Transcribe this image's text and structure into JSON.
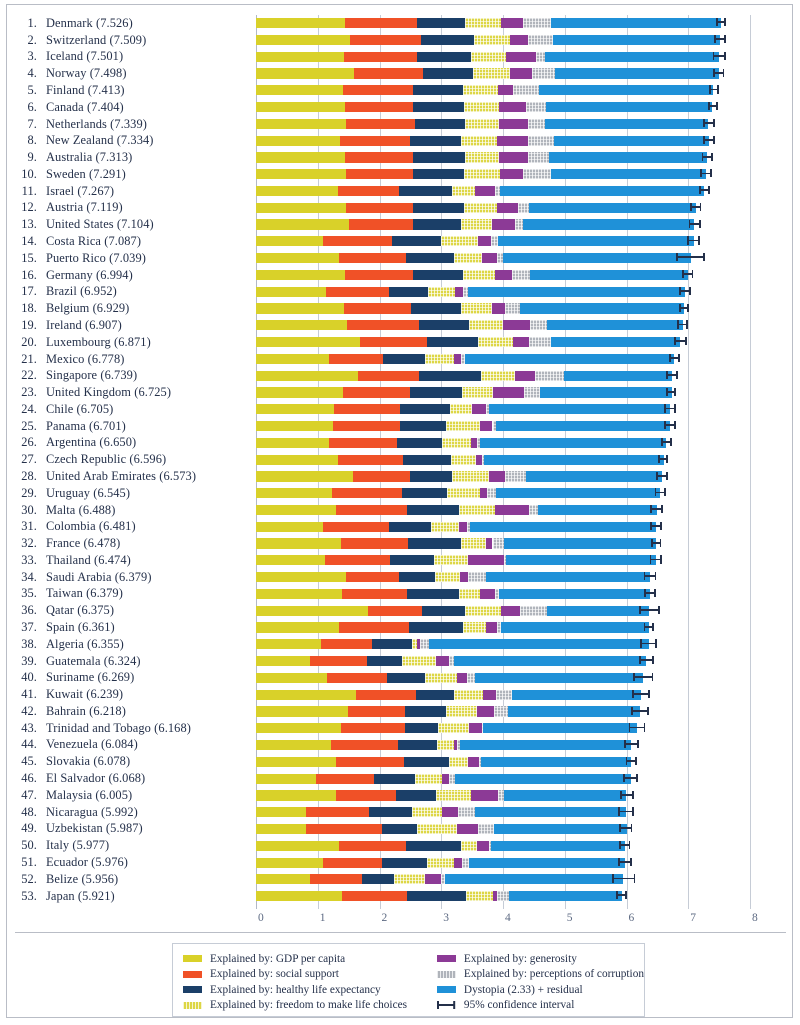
{
  "chart_data": {
    "type": "bar",
    "subtype": "stacked-horizontal",
    "title": "",
    "xlabel": "",
    "ylabel": "",
    "xlim": [
      0,
      8
    ],
    "xticks": [
      "0",
      "1",
      "2",
      "3",
      "4",
      "5",
      "6",
      "7",
      "8"
    ],
    "grid": true,
    "legend_position": "bottom",
    "series": [
      {
        "name": "Explained by: GDP per capita",
        "key": "gdp",
        "color": "#d9d129"
      },
      {
        "name": "Explained by: social support",
        "key": "social",
        "color": "#f05127"
      },
      {
        "name": "Explained by: healthy life expectancy",
        "key": "health",
        "color": "#1b3f68"
      },
      {
        "name": "Explained by: freedom to make life choices",
        "key": "freedom",
        "color": "#ddd645"
      },
      {
        "name": "Explained by: generosity",
        "key": "generosity",
        "color": "#8c3a96"
      },
      {
        "name": "Explained by: perceptions of corruption",
        "key": "corruption",
        "color": "#b0b4bb"
      },
      {
        "name": "Dystopia (2.33) + residual",
        "key": "dystopia",
        "color": "#1f91d8"
      }
    ],
    "rows": [
      {
        "rank": "1.",
        "country": "Denmark",
        "score": "7.526",
        "gdp": 1.44,
        "social": 1.16,
        "health": 0.79,
        "freedom": 0.58,
        "generosity": 0.36,
        "corruption": 0.44,
        "dystopia": 2.76,
        "ci_lo": 7.46,
        "ci_hi": 7.59
      },
      {
        "rank": "2.",
        "country": "Switzerland",
        "score": "7.509",
        "gdp": 1.53,
        "social": 1.14,
        "health": 0.86,
        "freedom": 0.59,
        "generosity": 0.28,
        "corruption": 0.41,
        "dystopia": 2.7,
        "ci_lo": 7.43,
        "ci_hi": 7.59
      },
      {
        "rank": "3.",
        "country": "Iceland",
        "score": "7.501",
        "gdp": 1.43,
        "social": 1.18,
        "health": 0.87,
        "freedom": 0.57,
        "generosity": 0.48,
        "corruption": 0.15,
        "dystopia": 2.82,
        "ci_lo": 7.41,
        "ci_hi": 7.59
      },
      {
        "rank": "4.",
        "country": "Norway",
        "score": "7.498",
        "gdp": 1.58,
        "social": 1.13,
        "health": 0.8,
        "freedom": 0.6,
        "generosity": 0.36,
        "corruption": 0.38,
        "dystopia": 2.65,
        "ci_lo": 7.42,
        "ci_hi": 7.57
      },
      {
        "rank": "5.",
        "country": "Finland",
        "score": "7.413",
        "gdp": 1.41,
        "social": 1.13,
        "health": 0.81,
        "freedom": 0.57,
        "generosity": 0.25,
        "corruption": 0.41,
        "dystopia": 2.82,
        "ci_lo": 7.35,
        "ci_hi": 7.48
      },
      {
        "rank": "6.",
        "country": "Canada",
        "score": "7.404",
        "gdp": 1.44,
        "social": 1.1,
        "health": 0.83,
        "freedom": 0.57,
        "generosity": 0.43,
        "corruption": 0.32,
        "dystopia": 2.7,
        "ci_lo": 7.34,
        "ci_hi": 7.47
      },
      {
        "rank": "7.",
        "country": "Netherlands",
        "score": "7.339",
        "gdp": 1.46,
        "social": 1.11,
        "health": 0.81,
        "freedom": 0.55,
        "generosity": 0.47,
        "corruption": 0.28,
        "dystopia": 2.64,
        "ci_lo": 7.26,
        "ci_hi": 7.42
      },
      {
        "rank": "8.",
        "country": "New Zealand",
        "score": "7.334",
        "gdp": 1.36,
        "social": 1.13,
        "health": 0.83,
        "freedom": 0.58,
        "generosity": 0.5,
        "corruption": 0.42,
        "dystopia": 2.51,
        "ci_lo": 7.25,
        "ci_hi": 7.42
      },
      {
        "rank": "9.",
        "country": "Australia",
        "score": "7.313",
        "gdp": 1.44,
        "social": 1.11,
        "health": 0.83,
        "freedom": 0.56,
        "generosity": 0.47,
        "corruption": 0.33,
        "dystopia": 2.57,
        "ci_lo": 7.23,
        "ci_hi": 7.39
      },
      {
        "rank": "10.",
        "country": "Sweden",
        "score": "7.291",
        "gdp": 1.45,
        "social": 1.09,
        "health": 0.83,
        "freedom": 0.58,
        "generosity": 0.38,
        "corruption": 0.44,
        "dystopia": 2.52,
        "ci_lo": 7.21,
        "ci_hi": 7.37
      },
      {
        "rank": "11.",
        "country": "Israel",
        "score": "7.267",
        "gdp": 1.33,
        "social": 0.99,
        "health": 0.85,
        "freedom": 0.37,
        "generosity": 0.33,
        "corruption": 0.08,
        "dystopia": 3.31,
        "ci_lo": 7.19,
        "ci_hi": 7.34
      },
      {
        "rank": "12.",
        "country": "Austria",
        "score": "7.119",
        "gdp": 1.45,
        "social": 1.09,
        "health": 0.83,
        "freedom": 0.54,
        "generosity": 0.33,
        "corruption": 0.18,
        "dystopia": 2.7,
        "ci_lo": 7.04,
        "ci_hi": 7.2
      },
      {
        "rank": "13.",
        "country": "United States",
        "score": "7.104",
        "gdp": 1.5,
        "social": 1.04,
        "health": 0.78,
        "freedom": 0.5,
        "generosity": 0.37,
        "corruption": 0.14,
        "dystopia": 2.77,
        "ci_lo": 7.02,
        "ci_hi": 7.19
      },
      {
        "rank": "14.",
        "country": "Costa Rica",
        "score": "7.087",
        "gdp": 1.09,
        "social": 1.11,
        "health": 0.79,
        "freedom": 0.6,
        "generosity": 0.22,
        "corruption": 0.11,
        "dystopia": 3.17,
        "ci_lo": 7.0,
        "ci_hi": 7.18
      },
      {
        "rank": "15.",
        "country": "Puerto Rico",
        "score": "7.039",
        "gdp": 1.35,
        "social": 1.08,
        "health": 0.77,
        "freedom": 0.46,
        "generosity": 0.24,
        "corruption": 0.1,
        "dystopia": 3.04,
        "ci_lo": 6.82,
        "ci_hi": 7.26
      },
      {
        "rank": "16.",
        "country": "Germany",
        "score": "6.994",
        "gdp": 1.44,
        "social": 1.1,
        "health": 0.81,
        "freedom": 0.52,
        "generosity": 0.28,
        "corruption": 0.28,
        "dystopia": 2.56,
        "ci_lo": 6.92,
        "ci_hi": 7.07
      },
      {
        "rank": "17.",
        "country": "Brazil",
        "score": "6.952",
        "gdp": 1.13,
        "social": 1.03,
        "health": 0.62,
        "freedom": 0.44,
        "generosity": 0.13,
        "corruption": 0.08,
        "dystopia": 3.52,
        "ci_lo": 6.87,
        "ci_hi": 7.03
      },
      {
        "rank": "18.",
        "country": "Belgium",
        "score": "6.929",
        "gdp": 1.42,
        "social": 1.09,
        "health": 0.81,
        "freedom": 0.5,
        "generosity": 0.21,
        "corruption": 0.25,
        "dystopia": 2.65,
        "ci_lo": 6.86,
        "ci_hi": 7.0
      },
      {
        "rank": "19.",
        "country": "Ireland",
        "score": "6.907",
        "gdp": 1.48,
        "social": 1.16,
        "health": 0.81,
        "freedom": 0.55,
        "generosity": 0.43,
        "corruption": 0.29,
        "dystopia": 2.19,
        "ci_lo": 6.83,
        "ci_hi": 6.98
      },
      {
        "rank": "20.",
        "country": "Luxembourg",
        "score": "6.871",
        "gdp": 1.69,
        "social": 1.08,
        "health": 0.82,
        "freedom": 0.58,
        "generosity": 0.25,
        "corruption": 0.35,
        "dystopia": 2.1,
        "ci_lo": 6.78,
        "ci_hi": 6.96
      },
      {
        "rank": "21.",
        "country": "Mexico",
        "score": "6.778",
        "gdp": 1.18,
        "social": 0.87,
        "health": 0.69,
        "freedom": 0.46,
        "generosity": 0.12,
        "corruption": 0.07,
        "dystopia": 3.38,
        "ci_lo": 6.71,
        "ci_hi": 6.85
      },
      {
        "rank": "22.",
        "country": "Singapore",
        "score": "6.739",
        "gdp": 1.65,
        "social": 0.99,
        "health": 1.0,
        "freedom": 0.56,
        "generosity": 0.32,
        "corruption": 0.47,
        "dystopia": 1.75,
        "ci_lo": 6.66,
        "ci_hi": 6.82
      },
      {
        "rank": "23.",
        "country": "United Kingdom",
        "score": "6.725",
        "gdp": 1.41,
        "social": 1.09,
        "health": 0.83,
        "freedom": 0.51,
        "generosity": 0.5,
        "corruption": 0.26,
        "dystopia": 2.13,
        "ci_lo": 6.66,
        "ci_hi": 6.79
      },
      {
        "rank": "24.",
        "country": "Chile",
        "score": "6.705",
        "gdp": 1.27,
        "social": 1.06,
        "health": 0.81,
        "freedom": 0.35,
        "generosity": 0.23,
        "corruption": 0.06,
        "dystopia": 2.93,
        "ci_lo": 6.62,
        "ci_hi": 6.79
      },
      {
        "rank": "25.",
        "country": "Panama",
        "score": "6.701",
        "gdp": 1.25,
        "social": 1.09,
        "health": 0.74,
        "freedom": 0.55,
        "generosity": 0.2,
        "corruption": 0.06,
        "dystopia": 2.81,
        "ci_lo": 6.62,
        "ci_hi": 6.78
      },
      {
        "rank": "26.",
        "country": "Argentina",
        "score": "6.650",
        "gdp": 1.19,
        "social": 1.1,
        "health": 0.72,
        "freedom": 0.47,
        "generosity": 0.1,
        "corruption": 0.05,
        "dystopia": 3.01,
        "ci_lo": 6.58,
        "ci_hi": 6.72
      },
      {
        "rank": "27.",
        "country": "Czech Republic",
        "score": "6.596",
        "gdp": 1.32,
        "social": 1.06,
        "health": 0.77,
        "freedom": 0.42,
        "generosity": 0.09,
        "corruption": 0.03,
        "dystopia": 2.91,
        "ci_lo": 6.53,
        "ci_hi": 6.66
      },
      {
        "rank": "28.",
        "country": "United Arab Emirates",
        "score": "6.573",
        "gdp": 1.57,
        "social": 0.92,
        "health": 0.69,
        "freedom": 0.6,
        "generosity": 0.26,
        "corruption": 0.34,
        "dystopia": 2.19,
        "ci_lo": 6.49,
        "ci_hi": 6.66
      },
      {
        "rank": "29.",
        "country": "Uruguay",
        "score": "6.545",
        "gdp": 1.23,
        "social": 1.13,
        "health": 0.74,
        "freedom": 0.52,
        "generosity": 0.12,
        "corruption": 0.15,
        "dystopia": 2.66,
        "ci_lo": 6.47,
        "ci_hi": 6.62
      },
      {
        "rank": "30.",
        "country": "Malta",
        "score": "6.488",
        "gdp": 1.3,
        "social": 1.15,
        "health": 0.83,
        "freedom": 0.59,
        "generosity": 0.55,
        "corruption": 0.14,
        "dystopia": 1.93,
        "ci_lo": 6.4,
        "ci_hi": 6.58
      },
      {
        "rank": "31.",
        "country": "Colombia",
        "score": "6.481",
        "gdp": 1.08,
        "social": 1.07,
        "health": 0.68,
        "freedom": 0.46,
        "generosity": 0.13,
        "corruption": 0.04,
        "dystopia": 3.02,
        "ci_lo": 6.4,
        "ci_hi": 6.56
      },
      {
        "rank": "32.",
        "country": "France",
        "score": "6.478",
        "gdp": 1.38,
        "social": 1.08,
        "health": 0.86,
        "freedom": 0.4,
        "generosity": 0.11,
        "corruption": 0.19,
        "dystopia": 2.46,
        "ci_lo": 6.41,
        "ci_hi": 6.55
      },
      {
        "rank": "33.",
        "country": "Thailand",
        "score": "6.474",
        "gdp": 1.11,
        "social": 1.06,
        "health": 0.71,
        "freedom": 0.56,
        "generosity": 0.58,
        "corruption": 0.03,
        "dystopia": 2.43,
        "ci_lo": 6.39,
        "ci_hi": 6.56
      },
      {
        "rank": "34.",
        "country": "Saudi Arabia",
        "score": "6.379",
        "gdp": 1.46,
        "social": 0.85,
        "health": 0.59,
        "freedom": 0.41,
        "generosity": 0.13,
        "corruption": 0.29,
        "dystopia": 2.65,
        "ci_lo": 6.29,
        "ci_hi": 6.47
      },
      {
        "rank": "35.",
        "country": "Taiwan",
        "score": "6.379",
        "gdp": 1.39,
        "social": 1.05,
        "health": 0.84,
        "freedom": 0.34,
        "generosity": 0.25,
        "corruption": 0.06,
        "dystopia": 2.45,
        "ci_lo": 6.3,
        "ci_hi": 6.46
      },
      {
        "rank": "36.",
        "country": "Qatar",
        "score": "6.375",
        "gdp": 1.82,
        "social": 0.87,
        "health": 0.7,
        "freedom": 0.57,
        "generosity": 0.32,
        "corruption": 0.44,
        "dystopia": 1.65,
        "ci_lo": 6.22,
        "ci_hi": 6.53
      },
      {
        "rank": "37.",
        "country": "Spain",
        "score": "6.361",
        "gdp": 1.34,
        "social": 1.13,
        "health": 0.89,
        "freedom": 0.37,
        "generosity": 0.17,
        "corruption": 0.06,
        "dystopia": 2.4,
        "ci_lo": 6.29,
        "ci_hi": 6.43
      },
      {
        "rank": "38.",
        "country": "Algeria",
        "score": "6.355",
        "gdp": 1.05,
        "social": 0.83,
        "health": 0.64,
        "freedom": 0.09,
        "generosity": 0.05,
        "corruption": 0.14,
        "dystopia": 3.56,
        "ci_lo": 6.23,
        "ci_hi": 6.48
      },
      {
        "rank": "39.",
        "country": "Guatemala",
        "score": "6.324",
        "gdp": 0.87,
        "social": 0.93,
        "health": 0.57,
        "freedom": 0.54,
        "generosity": 0.22,
        "corruption": 0.07,
        "dystopia": 3.12,
        "ci_lo": 6.22,
        "ci_hi": 6.43
      },
      {
        "rank": "40.",
        "country": "Suriname",
        "score": "6.269",
        "gdp": 1.15,
        "social": 0.97,
        "health": 0.61,
        "freedom": 0.52,
        "generosity": 0.16,
        "corruption": 0.13,
        "dystopia": 2.73,
        "ci_lo": 6.12,
        "ci_hi": 6.42
      },
      {
        "rank": "41.",
        "country": "Kuwait",
        "score": "6.239",
        "gdp": 1.62,
        "social": 0.97,
        "health": 0.62,
        "freedom": 0.47,
        "generosity": 0.21,
        "corruption": 0.25,
        "dystopia": 2.1,
        "ci_lo": 6.11,
        "ci_hi": 6.37
      },
      {
        "rank": "42.",
        "country": "Bahrain",
        "score": "6.218",
        "gdp": 1.49,
        "social": 0.93,
        "health": 0.65,
        "freedom": 0.51,
        "generosity": 0.28,
        "corruption": 0.22,
        "dystopia": 2.14,
        "ci_lo": 6.09,
        "ci_hi": 6.35
      },
      {
        "rank": "43.",
        "country": "Trinidad and Tobago",
        "score": "6.168",
        "gdp": 1.38,
        "social": 1.03,
        "health": 0.54,
        "freedom": 0.5,
        "generosity": 0.21,
        "corruption": 0.02,
        "dystopia": 2.49,
        "ci_lo": 6.05,
        "ci_hi": 6.29
      },
      {
        "rank": "44.",
        "country": "Venezuela",
        "score": "6.084",
        "gdp": 1.21,
        "social": 1.09,
        "health": 0.63,
        "freedom": 0.28,
        "generosity": 0.05,
        "corruption": 0.05,
        "dystopia": 2.77,
        "ci_lo": 5.98,
        "ci_hi": 6.19
      },
      {
        "rank": "45.",
        "country": "Slovakia",
        "score": "6.078",
        "gdp": 1.3,
        "social": 1.1,
        "health": 0.72,
        "freedom": 0.32,
        "generosity": 0.17,
        "corruption": 0.03,
        "dystopia": 2.44,
        "ci_lo": 6.0,
        "ci_hi": 6.16
      },
      {
        "rank": "46.",
        "country": "El Salvador",
        "score": "6.068",
        "gdp": 0.97,
        "social": 0.94,
        "health": 0.66,
        "freedom": 0.44,
        "generosity": 0.11,
        "corruption": 0.1,
        "dystopia": 2.85,
        "ci_lo": 5.96,
        "ci_hi": 6.17
      },
      {
        "rank": "47.",
        "country": "Malaysia",
        "score": "6.005",
        "gdp": 1.29,
        "social": 0.97,
        "health": 0.66,
        "freedom": 0.56,
        "generosity": 0.44,
        "corruption": 0.09,
        "dystopia": 1.99,
        "ci_lo": 5.91,
        "ci_hi": 6.1
      },
      {
        "rank": "48.",
        "country": "Nicaragua",
        "score": "5.992",
        "gdp": 0.81,
        "social": 1.02,
        "health": 0.7,
        "freedom": 0.49,
        "generosity": 0.25,
        "corruption": 0.28,
        "dystopia": 2.45,
        "ci_lo": 5.88,
        "ci_hi": 6.1
      },
      {
        "rank": "49.",
        "country": "Uzbekistan",
        "score": "5.987",
        "gdp": 0.81,
        "social": 1.23,
        "health": 0.57,
        "freedom": 0.64,
        "generosity": 0.34,
        "corruption": 0.27,
        "dystopia": 2.15,
        "ci_lo": 5.89,
        "ci_hi": 6.08
      },
      {
        "rank": "50.",
        "country": "Italy",
        "score": "5.977",
        "gdp": 1.35,
        "social": 1.08,
        "health": 0.89,
        "freedom": 0.26,
        "generosity": 0.19,
        "corruption": 0.03,
        "dystopia": 2.18,
        "ci_lo": 5.9,
        "ci_hi": 6.05
      },
      {
        "rank": "51.",
        "country": "Ecuador",
        "score": "5.976",
        "gdp": 1.08,
        "social": 0.96,
        "health": 0.73,
        "freedom": 0.44,
        "generosity": 0.12,
        "corruption": 0.12,
        "dystopia": 2.52,
        "ci_lo": 5.88,
        "ci_hi": 6.07
      },
      {
        "rank": "52.",
        "country": "Belize",
        "score": "5.956",
        "gdp": 0.87,
        "social": 0.84,
        "health": 0.52,
        "freedom": 0.51,
        "generosity": 0.25,
        "corruption": 0.07,
        "dystopia": 2.89,
        "ci_lo": 5.78,
        "ci_hi": 6.13
      },
      {
        "rank": "53.",
        "country": "Japan",
        "score": "5.921",
        "gdp": 1.39,
        "social": 1.06,
        "health": 0.95,
        "freedom": 0.44,
        "generosity": 0.07,
        "corruption": 0.18,
        "dystopia": 1.83,
        "ci_lo": 5.85,
        "ci_hi": 5.99
      }
    ]
  },
  "legend": {
    "column_one": [
      {
        "label": "Explained by: GDP per capita",
        "swatch": "gdp-swatch"
      },
      {
        "label": "Explained by: social support",
        "swatch": "social-swatch"
      },
      {
        "label": "Explained by: healthy life expectancy",
        "swatch": "health-swatch"
      },
      {
        "label": "Explained by: freedom to make life choices",
        "swatch": "freedom-swatch"
      }
    ],
    "column_two": [
      {
        "label": "Explained by: generosity",
        "swatch": "generosity-swatch"
      },
      {
        "label": "Explained by: perceptions of corruption",
        "swatch": "corruption-swatch"
      },
      {
        "label": "Dystopia (2.33) + residual",
        "swatch": "dystopia-swatch"
      },
      {
        "label": "95% confidence interval",
        "swatch": "confidence-interval-swatch"
      }
    ]
  }
}
